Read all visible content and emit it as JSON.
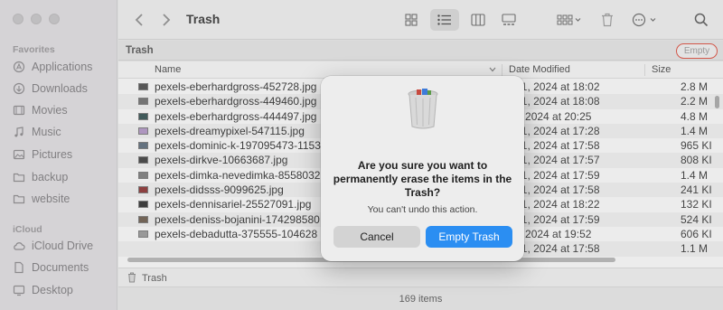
{
  "sidebar": {
    "favorites_heading": "Favorites",
    "favorites": [
      {
        "label": "Applications",
        "icon": "applications-icon"
      },
      {
        "label": "Downloads",
        "icon": "downloads-icon"
      },
      {
        "label": "Movies",
        "icon": "movies-icon"
      },
      {
        "label": "Music",
        "icon": "music-icon"
      },
      {
        "label": "Pictures",
        "icon": "pictures-icon"
      },
      {
        "label": "backup",
        "icon": "folder-icon"
      },
      {
        "label": "website",
        "icon": "folder-icon"
      }
    ],
    "icloud_heading": "iCloud",
    "icloud": [
      {
        "label": "iCloud Drive",
        "icon": "icloud-icon"
      },
      {
        "label": "Documents",
        "icon": "documents-icon"
      },
      {
        "label": "Desktop",
        "icon": "desktop-icon"
      }
    ]
  },
  "toolbar": {
    "title": "Trash"
  },
  "pathbar": {
    "title": "Trash",
    "empty_label": "Empty"
  },
  "columns": {
    "name": "Name",
    "date": "Date Modified",
    "size": "Size"
  },
  "files": [
    {
      "name": "pexels-eberhardgross-452728.jpg",
      "date": "g 11, 2024 at 18:02",
      "size": "2.8 M"
    },
    {
      "name": "pexels-eberhardgross-449460.jpg",
      "date": "g 11, 2024 at 18:08",
      "size": "2.2 M"
    },
    {
      "name": "pexels-eberhardgross-444497.jpg",
      "date": "24, 2024 at 20:25",
      "size": "4.8 M"
    },
    {
      "name": "pexels-dreamypixel-547115.jpg",
      "date": "g 11, 2024 at 17:28",
      "size": "1.4 M"
    },
    {
      "name": "pexels-dominic-k-197095473-1153",
      "date": "g 11, 2024 at 17:58",
      "size": "965 KI"
    },
    {
      "name": "pexels-dirkve-10663687.jpg",
      "date": "g 11, 2024 at 17:57",
      "size": "808 KI"
    },
    {
      "name": "pexels-dimka-nevedimka-8558032",
      "date": "g 11, 2024 at 17:59",
      "size": "1.4 M"
    },
    {
      "name": "pexels-didsss-9099625.jpg",
      "date": "g 11, 2024 at 17:58",
      "size": "241 KI"
    },
    {
      "name": "pexels-dennisariel-25527091.jpg",
      "date": "g 11, 2024 at 18:22",
      "size": "132 KI"
    },
    {
      "name": "pexels-deniss-bojanini-174298580",
      "date": "g 11, 2024 at 17:59",
      "size": "524 KI"
    },
    {
      "name": "pexels-debadutta-375555-104628",
      "date": "24, 2024 at 19:52",
      "size": "606 KI"
    },
    {
      "name": "",
      "date": "g 11, 2024 at 17:58",
      "size": "1.1 M"
    },
    {
      "name": "",
      "date": "",
      "size": ""
    }
  ],
  "path_footer": "Trash",
  "status": "169 items",
  "dialog": {
    "title": "Are you sure you want to permanently erase the items in the Trash?",
    "message": "You can't undo this action.",
    "cancel_label": "Cancel",
    "confirm_label": "Empty Trash"
  },
  "colors": {
    "accent": "#2b8ef2",
    "highlight_ring": "#e04a3a"
  }
}
